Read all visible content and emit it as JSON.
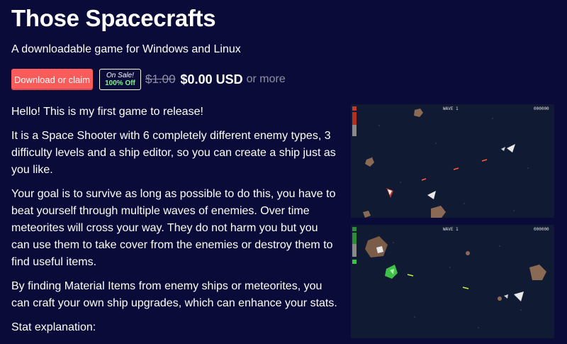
{
  "game": {
    "title": "Those Spacecrafts",
    "subtitle": "A downloadable game for Windows and Linux"
  },
  "purchase": {
    "download_label": "Download or claim",
    "sale_line1": "On Sale!",
    "sale_line2": "100% Off",
    "original_price": "$1.00",
    "current_price": "$0.00 USD",
    "or_more": "or more"
  },
  "description": {
    "paragraphs": [
      "Hello! This is my first game to release!",
      "It is a Space Shooter with 6 completely different enemy types, 3 difficulty levels and a ship editor, so you can create a ship just as you like.",
      "Your goal is to survive as long as possible to do this, you have to beat yourself through multiple waves of enemies. Over time meteorites will cross your way. They do not harm you but you can use them to take cover from the enemies or destroy them to find useful items.",
      "By finding Material Items from enemy ships or meteorites, you can craft your own ship upgrades, which can enhance your stats.",
      "Stat explanation:"
    ]
  },
  "screenshots": {
    "hud_left": "WAVE 1",
    "hud_right": "000000"
  },
  "colors": {
    "background": "#0b0b3a",
    "accent": "#fa5c5c",
    "sale_green": "#7ef58a",
    "muted": "#8f8fa8"
  }
}
